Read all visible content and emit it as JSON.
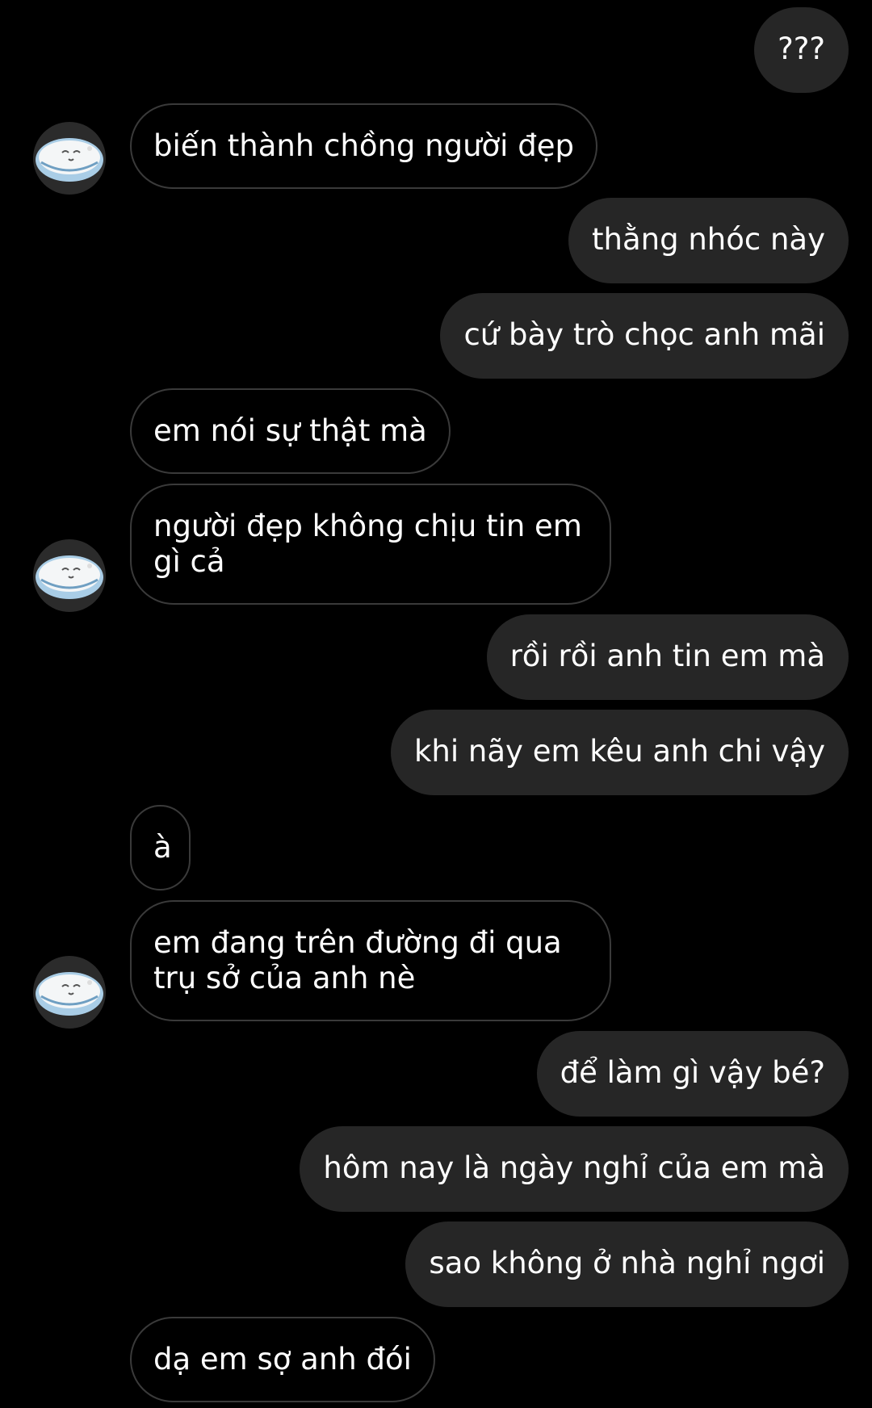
{
  "colors": {
    "background": "#000000",
    "sent_bubble": "#262626",
    "received_border": "#3a3a3a",
    "text": "#ffffff"
  },
  "avatar": {
    "icon": "sleeping-cat-avatar-icon"
  },
  "messages": [
    {
      "side": "sent",
      "text": "???"
    },
    {
      "side": "received",
      "text": "biến thành chồng người đẹp"
    },
    {
      "side": "sent",
      "text": "thằng nhóc này"
    },
    {
      "side": "sent",
      "text": "cứ bày trò chọc anh mãi"
    },
    {
      "side": "received",
      "text": "em nói sự thật mà"
    },
    {
      "side": "received",
      "text": "người đẹp không chịu tin em gì cả"
    },
    {
      "side": "sent",
      "text": "rồi rồi anh tin em mà"
    },
    {
      "side": "sent",
      "text": "khi nãy em kêu anh chi vậy"
    },
    {
      "side": "received",
      "text": "à"
    },
    {
      "side": "received",
      "text": "em đang trên đường đi qua trụ sở của anh nè"
    },
    {
      "side": "sent",
      "text": "để làm gì vậy bé?"
    },
    {
      "side": "sent",
      "text": "hôm nay là ngày nghỉ của em mà"
    },
    {
      "side": "sent",
      "text": "sao không ở nhà nghỉ ngơi"
    },
    {
      "side": "received",
      "text": "dạ em sợ anh đói"
    }
  ]
}
